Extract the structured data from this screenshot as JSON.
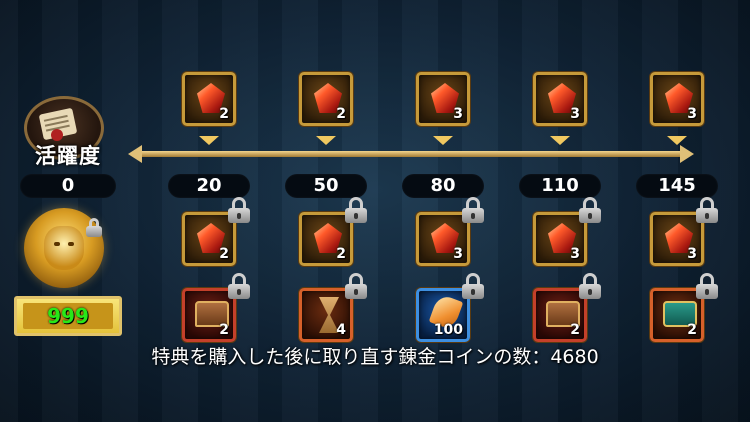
{
  "activity": {
    "label": "活躍度",
    "current": "0",
    "icon": "scroll-quill-icon"
  },
  "milestones": [
    {
      "value": "20",
      "top_reward": {
        "icon": "red-gem-icon",
        "qty": "2"
      },
      "mid_reward": {
        "icon": "red-gem-icon",
        "qty": "2"
      },
      "bottom_reward": {
        "icon": "treasure-chest-icon",
        "qty": "2"
      }
    },
    {
      "value": "50",
      "top_reward": {
        "icon": "red-gem-icon",
        "qty": "2"
      },
      "mid_reward": {
        "icon": "red-gem-icon",
        "qty": "2"
      },
      "bottom_reward": {
        "icon": "hourglass-icon",
        "qty": "4"
      }
    },
    {
      "value": "80",
      "top_reward": {
        "icon": "red-gem-icon",
        "qty": "3"
      },
      "mid_reward": {
        "icon": "red-gem-icon",
        "qty": "3"
      },
      "bottom_reward": {
        "icon": "golden-feather-icon",
        "qty": "100"
      }
    },
    {
      "value": "110",
      "top_reward": {
        "icon": "red-gem-icon",
        "qty": "3"
      },
      "mid_reward": {
        "icon": "red-gem-icon",
        "qty": "3"
      },
      "bottom_reward": {
        "icon": "jade-chest-icon",
        "qty": "2"
      }
    },
    {
      "value": "145",
      "top_reward": {
        "icon": "red-gem-icon",
        "qty": "3"
      },
      "mid_reward": {
        "icon": "red-gem-icon",
        "qty": "3"
      },
      "bottom_reward": {
        "icon": "teal-chest-icon",
        "qty": "2"
      }
    }
  ],
  "premium": {
    "icon": "golden-lion-icon",
    "counter": "999"
  },
  "footer": {
    "text": "特典を購入した後に取り直す錬金コインの数：4680"
  },
  "colors": {
    "gold_border": "#c69a3a",
    "counter_text": "#28e818",
    "track": "#e0c078"
  }
}
